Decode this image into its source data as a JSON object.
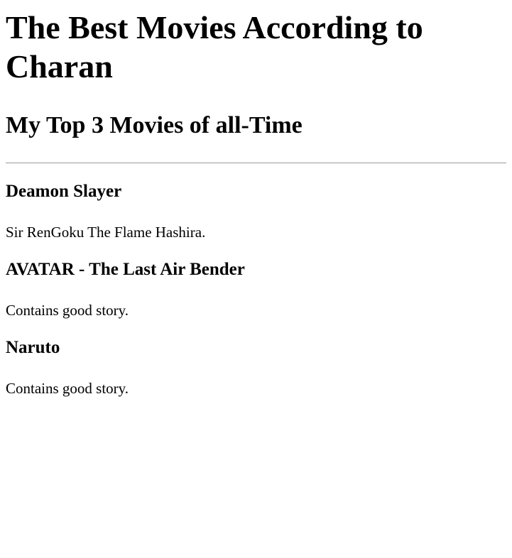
{
  "page": {
    "title": "The Best Movies According to Charan",
    "subtitle": "My Top 3 Movies of all-Time"
  },
  "movies": [
    {
      "name": "Deamon Slayer",
      "description": "Sir RenGoku The Flame Hashira."
    },
    {
      "name": "AVATAR - The Last Air Bender",
      "description": "Contains good story."
    },
    {
      "name": "Naruto",
      "description": "Contains good story."
    }
  ]
}
